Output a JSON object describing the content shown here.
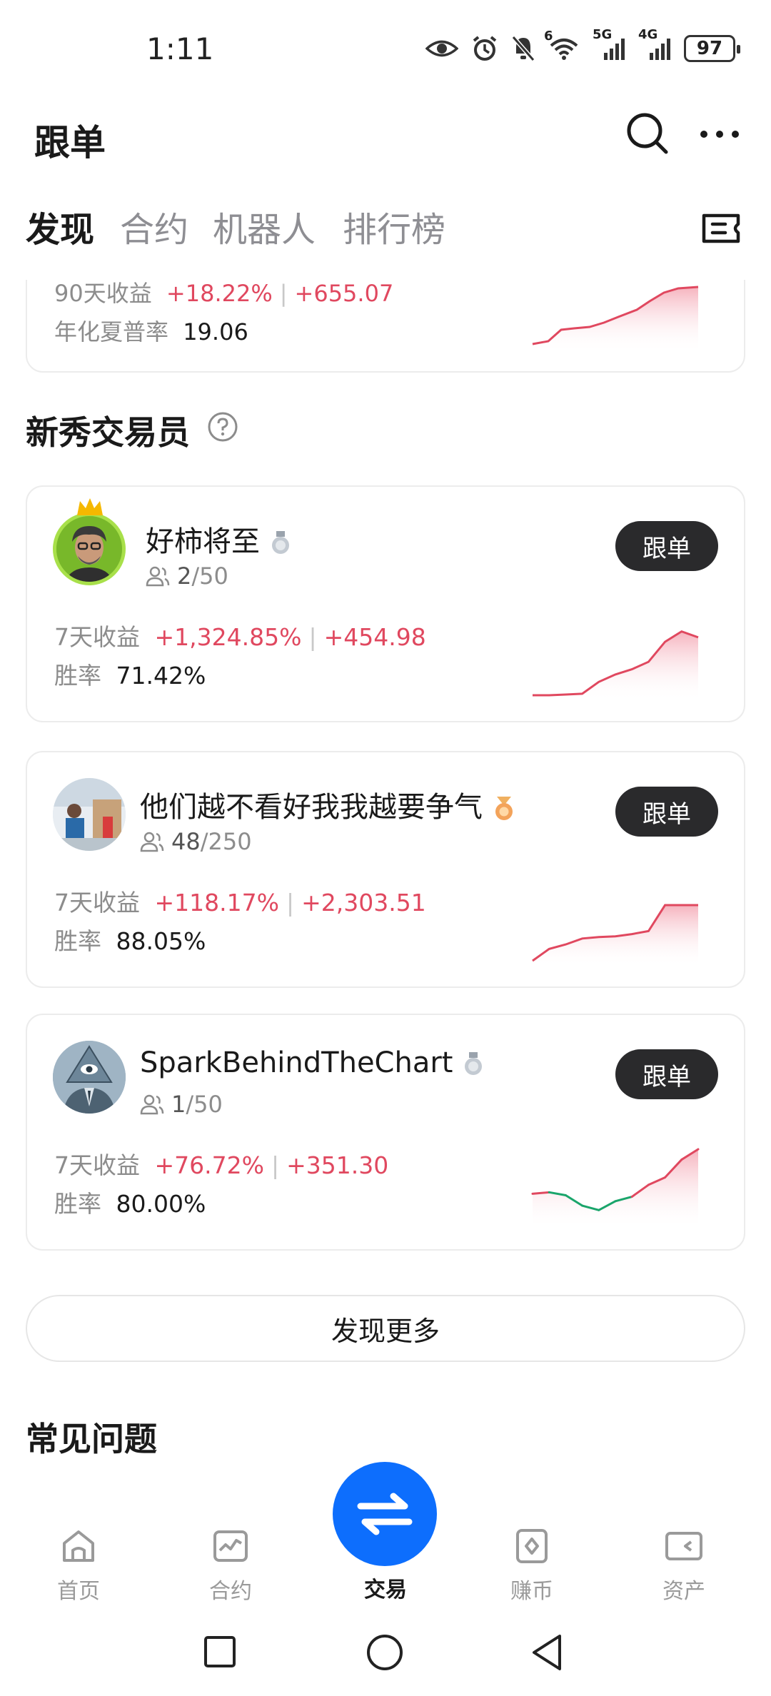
{
  "status_bar": {
    "time": "1:11",
    "battery": "97",
    "icons": [
      "eye-icon",
      "alarm-icon",
      "mute-icon",
      "wifi-icon",
      "signal-5g-icon",
      "signal-4g-icon",
      "battery-icon"
    ],
    "net_5g": "5G",
    "net_4g": "4G",
    "wifi_tag": "6"
  },
  "header": {
    "title": "跟单"
  },
  "tabs": [
    "发现",
    "合约",
    "机器人",
    "排行榜"
  ],
  "top_card": {
    "return_label": "90天收益",
    "return_pct": "+18.22%",
    "return_amount": "+655.07",
    "sharpe_label": "年化夏普率",
    "sharpe_value": "19.06"
  },
  "section_title": "新秀交易员",
  "traders": [
    {
      "name": "好柿将至",
      "followers": "2",
      "followers_max": "/50",
      "return_label": "7天收益",
      "return_pct": "+1,324.85%",
      "return_amount": "+454.98",
      "win_label": "胜率",
      "win_rate": "71.42%",
      "button": "跟单",
      "spark": [
        0,
        0,
        0.01,
        0.02,
        0.18,
        0.28,
        0.35,
        0.45,
        0.72,
        0.86,
        0.78
      ]
    },
    {
      "name": "他们越不看好我我越要争气",
      "followers": "48",
      "followers_max": "/250",
      "return_label": "7天收益",
      "return_pct": "+118.17%",
      "return_amount": "+2,303.51",
      "win_label": "胜率",
      "win_rate": "88.05%",
      "button": "跟单",
      "spark": [
        0,
        0.16,
        0.22,
        0.3,
        0.32,
        0.33,
        0.36,
        0.4,
        0.75,
        0.75,
        0.75
      ]
    },
    {
      "name": "SparkBehindTheChart",
      "followers": "1",
      "followers_max": "/50",
      "return_label": "7天收益",
      "return_pct": "+76.72%",
      "return_amount": "+351.30",
      "win_label": "胜率",
      "win_rate": "80.00%",
      "button": "跟单",
      "spark": [
        0.4,
        0.42,
        0.38,
        0.24,
        0.18,
        0.3,
        0.36,
        0.52,
        0.62,
        0.86,
        1.0
      ]
    }
  ],
  "discover_more": "发现更多",
  "faq_title": "常见问题",
  "bottom_nav": {
    "items": [
      "首页",
      "合约",
      "交易",
      "赚币",
      "资产"
    ],
    "active": "交易"
  },
  "colors": {
    "up": "#e0485f",
    "down": "#1aa56b",
    "accent": "#0d6efd",
    "button": "#2a2a2c"
  }
}
